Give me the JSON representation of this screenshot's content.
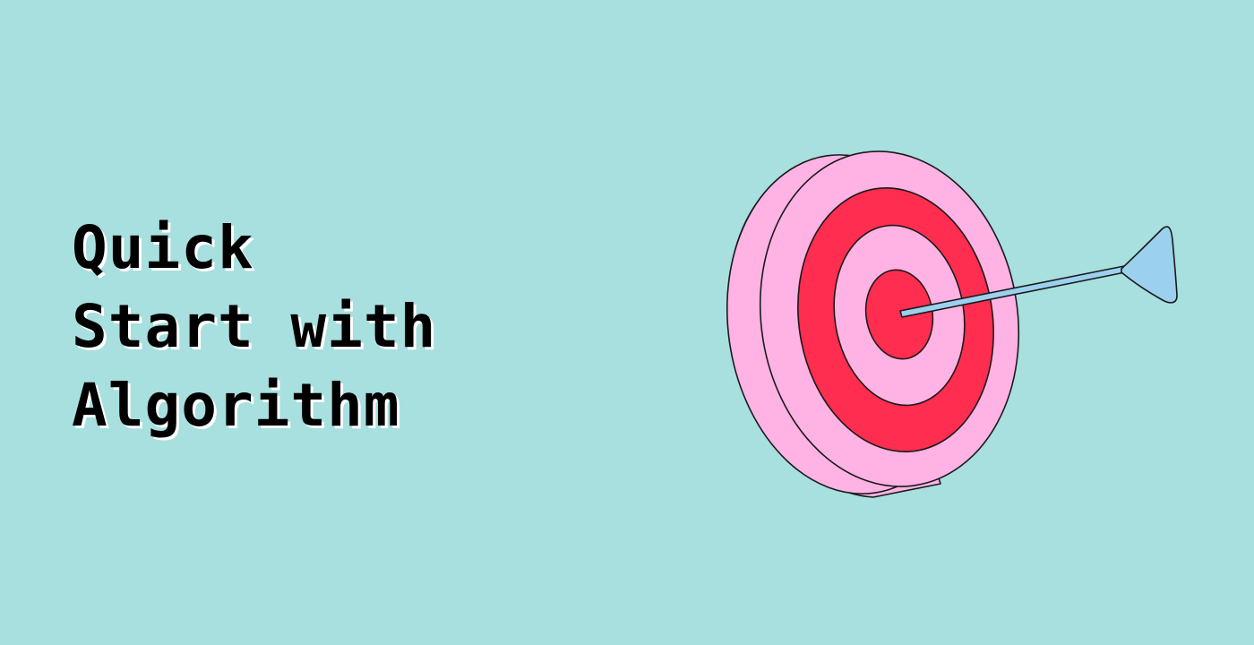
{
  "banner": {
    "title_lines": [
      "Quick",
      "Start with",
      "Algorithm"
    ],
    "colors": {
      "background": "#a8dfdf",
      "title_text": "#000000",
      "title_shadow": "#ffffff",
      "target_pink": "#ffb3e4",
      "target_red": "#ff2d4f",
      "arrow_blue": "#9bd1ee",
      "outline": "#1a1a1a"
    },
    "illustration": {
      "icon": "target-with-arrow-icon"
    }
  }
}
